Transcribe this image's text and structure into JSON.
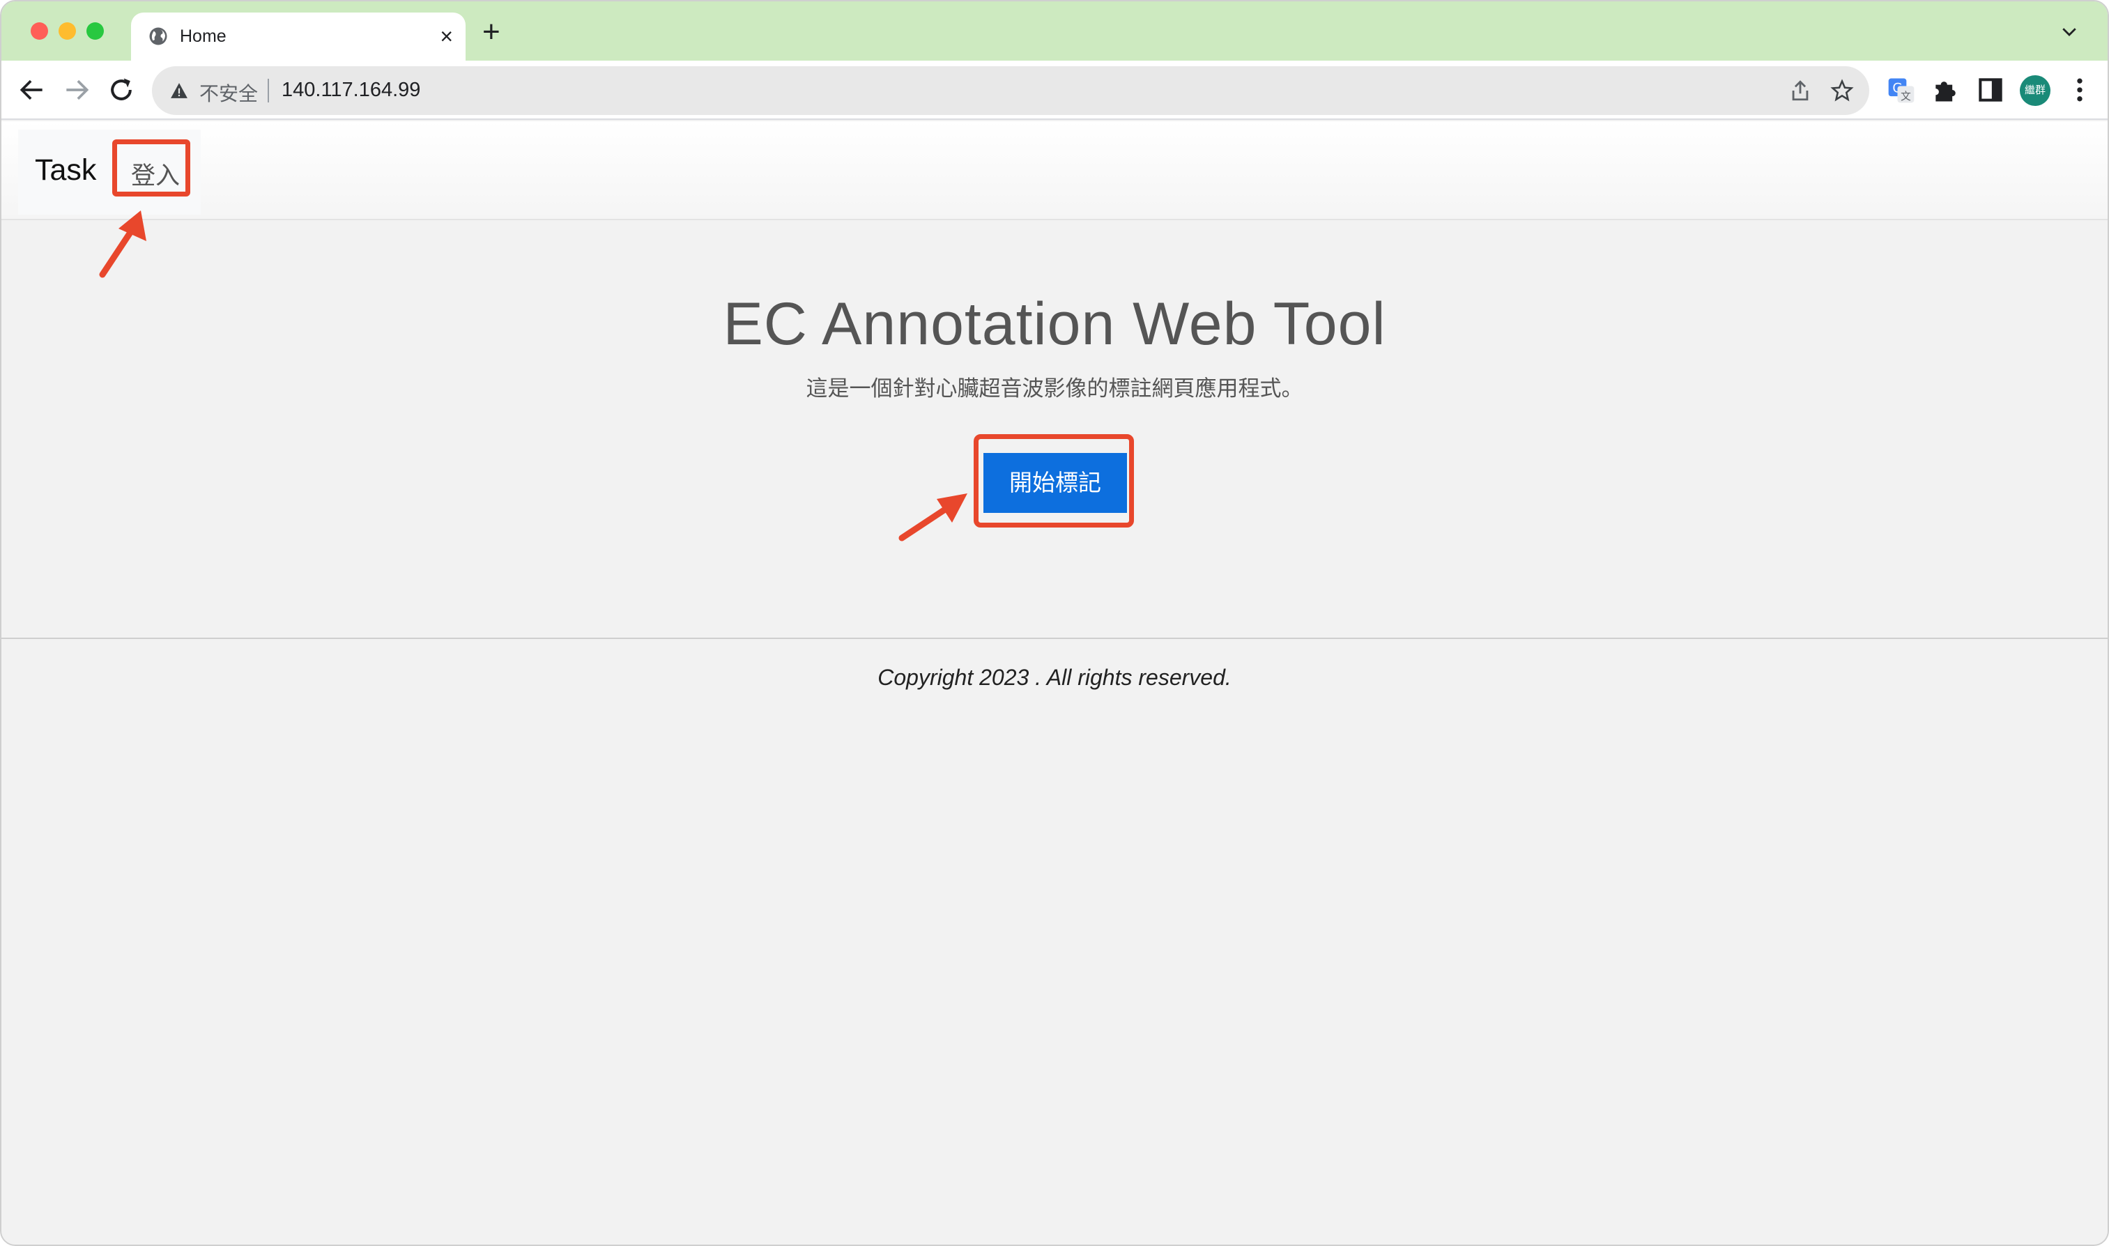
{
  "browser": {
    "tab_title": "Home",
    "tab_close": "×",
    "new_tab": "+",
    "security_label": "不安全",
    "url": "140.117.164.99",
    "profile_label": "繼群"
  },
  "navbar": {
    "brand": "Task",
    "login": "登入"
  },
  "hero": {
    "title": "EC Annotation Web Tool",
    "subtitle": "這是一個針對心臟超音波影像的標註網頁應用程式。",
    "start_button": "開始標記"
  },
  "footer": {
    "copyright": "Copyright 2023 . All rights reserved."
  },
  "colors": {
    "tab_strip": "#cdeac0",
    "primary_button": "#0d6fde",
    "highlight": "#e8472c"
  }
}
